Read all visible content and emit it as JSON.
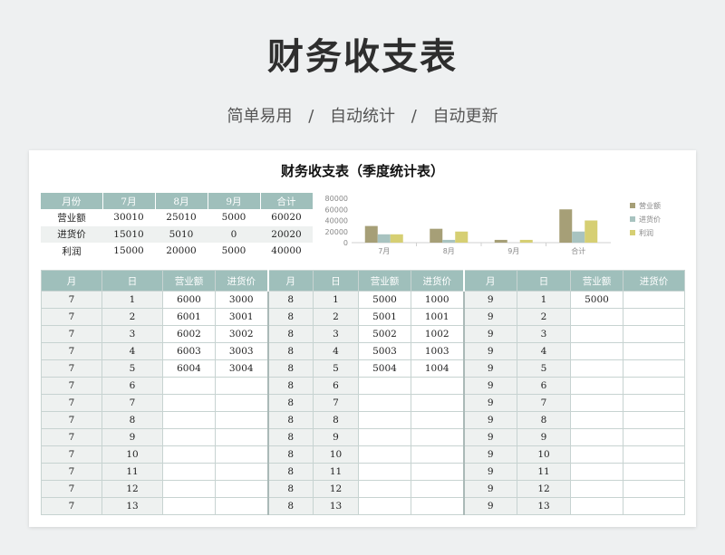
{
  "title": "财务收支表",
  "subtitle": [
    "简单易用",
    "自动统计",
    "自动更新"
  ],
  "subtitle_sep": "/",
  "sheet_title": "财务收支表（季度统计表）",
  "summary": {
    "headers": [
      "月份",
      "7月",
      "8月",
      "9月",
      "合计"
    ],
    "rows": [
      [
        "营业额",
        "30010",
        "25010",
        "5000",
        "60020"
      ],
      [
        "进货价",
        "15010",
        "5010",
        "0",
        "20020"
      ],
      [
        "利润",
        "15000",
        "20000",
        "5000",
        "40000"
      ]
    ]
  },
  "chart_data": {
    "type": "bar",
    "categories": [
      "7月",
      "8月",
      "9月",
      "合计"
    ],
    "series": [
      {
        "name": "营业额",
        "values": [
          30010,
          25010,
          5000,
          60020
        ]
      },
      {
        "name": "进货价",
        "values": [
          15010,
          5010,
          0,
          20020
        ]
      },
      {
        "name": "利润",
        "values": [
          15000,
          20000,
          5000,
          40000
        ]
      }
    ],
    "yticks": [
      "80000",
      "60000",
      "40000",
      "20000",
      "0"
    ],
    "ylim": [
      0,
      80000
    ],
    "colors": [
      "#a69f77",
      "#a8c3c0",
      "#d6cf73"
    ],
    "legend": "right"
  },
  "main": {
    "headers": [
      "月",
      "日",
      "营业额",
      "进货价",
      "月",
      "日",
      "营业额",
      "进货价",
      "月",
      "日",
      "营业额",
      "进货价"
    ],
    "rows": [
      [
        "7",
        "1",
        "6000",
        "3000",
        "8",
        "1",
        "5000",
        "1000",
        "9",
        "1",
        "5000",
        ""
      ],
      [
        "7",
        "2",
        "6001",
        "3001",
        "8",
        "2",
        "5001",
        "1001",
        "9",
        "2",
        "",
        ""
      ],
      [
        "7",
        "3",
        "6002",
        "3002",
        "8",
        "3",
        "5002",
        "1002",
        "9",
        "3",
        "",
        ""
      ],
      [
        "7",
        "4",
        "6003",
        "3003",
        "8",
        "4",
        "5003",
        "1003",
        "9",
        "4",
        "",
        ""
      ],
      [
        "7",
        "5",
        "6004",
        "3004",
        "8",
        "5",
        "5004",
        "1004",
        "9",
        "5",
        "",
        ""
      ],
      [
        "7",
        "6",
        "",
        "",
        "8",
        "6",
        "",
        "",
        "9",
        "6",
        "",
        ""
      ],
      [
        "7",
        "7",
        "",
        "",
        "8",
        "7",
        "",
        "",
        "9",
        "7",
        "",
        ""
      ],
      [
        "7",
        "8",
        "",
        "",
        "8",
        "8",
        "",
        "",
        "9",
        "8",
        "",
        ""
      ],
      [
        "7",
        "9",
        "",
        "",
        "8",
        "9",
        "",
        "",
        "9",
        "9",
        "",
        ""
      ],
      [
        "7",
        "10",
        "",
        "",
        "8",
        "10",
        "",
        "",
        "9",
        "10",
        "",
        ""
      ],
      [
        "7",
        "11",
        "",
        "",
        "8",
        "11",
        "",
        "",
        "9",
        "11",
        "",
        ""
      ],
      [
        "7",
        "12",
        "",
        "",
        "8",
        "12",
        "",
        "",
        "9",
        "12",
        "",
        ""
      ],
      [
        "7",
        "13",
        "",
        "",
        "8",
        "13",
        "",
        "",
        "9",
        "13",
        "",
        ""
      ]
    ]
  }
}
